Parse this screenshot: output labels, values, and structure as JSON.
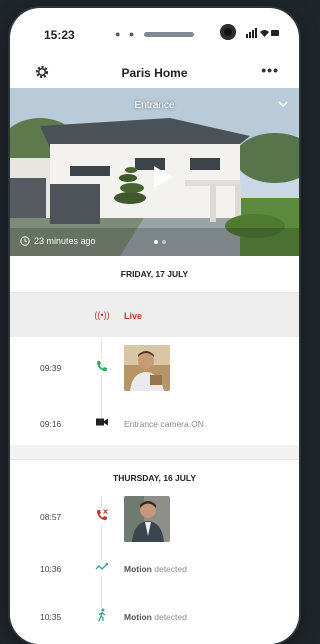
{
  "status_bar": {
    "time": "15:23"
  },
  "header": {
    "title": "Paris Home"
  },
  "camera_view": {
    "label": "Entrance",
    "last_seen": "23 minutes ago"
  },
  "days": [
    {
      "label": "FRIDAY, 17 JULY",
      "events": [
        {
          "time": "",
          "type": "live",
          "text": "Live"
        },
        {
          "time": "09:39",
          "type": "call-answered",
          "text": ""
        },
        {
          "time": "09:16",
          "type": "camera-on",
          "text": "Entrance camera ON"
        }
      ]
    },
    {
      "label": "THURSDAY, 16 JULY",
      "events": [
        {
          "time": "08:57",
          "type": "call-missed",
          "text": ""
        },
        {
          "time": "10:36",
          "type": "motion",
          "text_bold": "Motion",
          "text": "detected"
        },
        {
          "time": "10:35",
          "type": "motion-person",
          "text_bold": "Motion",
          "text": "detected"
        }
      ]
    }
  ],
  "colors": {
    "live": "#c0392b",
    "answered": "#27ae60",
    "missed": "#c0392b",
    "motion": "#3aa0a0"
  }
}
